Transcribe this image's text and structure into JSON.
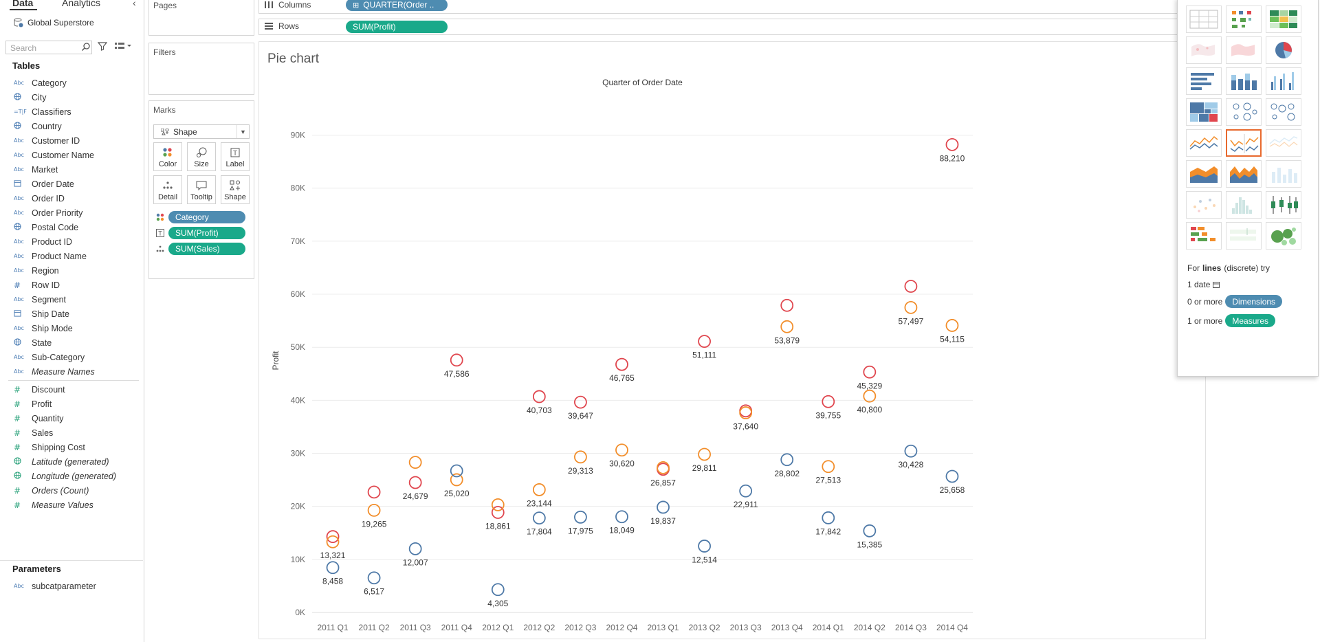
{
  "data_pane": {
    "tabs": [
      "Data",
      "Analytics"
    ],
    "datasource": "Global Superstore",
    "search_placeholder": "Search",
    "tables_heading": "Tables",
    "dimensions": [
      {
        "name": "Category",
        "type": "Abc"
      },
      {
        "name": "City",
        "type": "geo"
      },
      {
        "name": "Classifiers",
        "type": "=T|F"
      },
      {
        "name": "Country",
        "type": "geo"
      },
      {
        "name": "Customer ID",
        "type": "Abc"
      },
      {
        "name": "Customer Name",
        "type": "Abc"
      },
      {
        "name": "Market",
        "type": "Abc"
      },
      {
        "name": "Order Date",
        "type": "date"
      },
      {
        "name": "Order ID",
        "type": "Abc"
      },
      {
        "name": "Order Priority",
        "type": "Abc"
      },
      {
        "name": "Postal Code",
        "type": "geo"
      },
      {
        "name": "Product ID",
        "type": "Abc"
      },
      {
        "name": "Product Name",
        "type": "Abc"
      },
      {
        "name": "Region",
        "type": "Abc"
      },
      {
        "name": "Row ID",
        "type": "#"
      },
      {
        "name": "Segment",
        "type": "Abc"
      },
      {
        "name": "Ship Date",
        "type": "date"
      },
      {
        "name": "Ship Mode",
        "type": "Abc"
      },
      {
        "name": "State",
        "type": "geo"
      },
      {
        "name": "Sub-Category",
        "type": "Abc"
      },
      {
        "name": "Measure Names",
        "type": "Abc",
        "italic": true
      }
    ],
    "measures": [
      {
        "name": "Discount",
        "type": "#"
      },
      {
        "name": "Profit",
        "type": "#"
      },
      {
        "name": "Quantity",
        "type": "#"
      },
      {
        "name": "Sales",
        "type": "#"
      },
      {
        "name": "Shipping Cost",
        "type": "#"
      },
      {
        "name": "Latitude (generated)",
        "type": "geo",
        "italic": true
      },
      {
        "name": "Longitude (generated)",
        "type": "geo",
        "italic": true
      },
      {
        "name": "Orders (Count)",
        "type": "#",
        "italic": true
      },
      {
        "name": "Measure Values",
        "type": "#",
        "italic": true
      }
    ],
    "parameters_heading": "Parameters",
    "parameters": [
      {
        "name": "subcatparameter",
        "type": "Abc"
      }
    ]
  },
  "cards": {
    "pages": "Pages",
    "filters": "Filters",
    "marks": "Marks",
    "mark_type": "Shape",
    "mark_buttons": [
      "Color",
      "Size",
      "Label",
      "Detail",
      "Tooltip",
      "Shape"
    ],
    "mark_pills": [
      {
        "label": "Category",
        "kind": "dimension",
        "encoding": "color"
      },
      {
        "label": "SUM(Profit)",
        "kind": "measure",
        "encoding": "label"
      },
      {
        "label": "SUM(Sales)",
        "kind": "measure",
        "encoding": "detail"
      }
    ]
  },
  "shelves": {
    "columns_label": "Columns",
    "columns_pill": "QUARTER(Order ..",
    "rows_label": "Rows",
    "rows_pill": "SUM(Profit)"
  },
  "sheet_title": "Pie chart",
  "colors": {
    "red": "#e0464e",
    "orange": "#f28e2b",
    "blue": "#4e79a7",
    "dim_pill": "#4e8cb1",
    "measure_pill": "#1aa98a",
    "selected_thumb": "#e8692d"
  },
  "chart_data": {
    "type": "scatter",
    "title": "Quarter of Order Date",
    "ylabel": "Profit",
    "categories": [
      "2011 Q1",
      "2011 Q2",
      "2011 Q3",
      "2011 Q4",
      "2012 Q1",
      "2012 Q2",
      "2012 Q3",
      "2012 Q4",
      "2013 Q1",
      "2013 Q2",
      "2013 Q3",
      "2013 Q4",
      "2014 Q1",
      "2014 Q2",
      "2014 Q3",
      "2014 Q4"
    ],
    "ylim": [
      0,
      95000
    ],
    "yticks": [
      0,
      10000,
      20000,
      30000,
      40000,
      50000,
      60000,
      70000,
      80000,
      90000
    ],
    "ytick_labels": [
      "0K",
      "10K",
      "20K",
      "30K",
      "40K",
      "50K",
      "60K",
      "70K",
      "80K",
      "90K"
    ],
    "series": [
      {
        "color": "red",
        "values": [
          14300,
          22700,
          24500,
          47586,
          18861,
          40703,
          39647,
          46765,
          27000,
          51111,
          38000,
          57900,
          39755,
          45329,
          61500,
          88210
        ]
      },
      {
        "color": "orange",
        "values": [
          13321,
          19265,
          28300,
          25020,
          20300,
          23144,
          29313,
          30620,
          27300,
          29811,
          37640,
          53879,
          27513,
          40800,
          57497,
          54115
        ]
      },
      {
        "color": "blue",
        "values": [
          8458,
          6517,
          12007,
          26700,
          4305,
          17804,
          17975,
          18049,
          19837,
          12514,
          22911,
          28802,
          17842,
          15385,
          30428,
          25658
        ]
      }
    ],
    "data_labels": [
      {
        "category": "2011 Q1",
        "text": "13,321"
      },
      {
        "category": "2011 Q1",
        "text": "8,458"
      },
      {
        "category": "2011 Q2",
        "text": "19,265"
      },
      {
        "category": "2011 Q2",
        "text": "6,517"
      },
      {
        "category": "2011 Q3",
        "text": "24,679"
      },
      {
        "category": "2011 Q3",
        "text": "12,007"
      },
      {
        "category": "2011 Q4",
        "text": "47,586"
      },
      {
        "category": "2011 Q4",
        "text": "25,020"
      },
      {
        "category": "2012 Q1",
        "text": "18,861"
      },
      {
        "category": "2012 Q1",
        "text": "4,305"
      },
      {
        "category": "2012 Q2",
        "text": "40,703"
      },
      {
        "category": "2012 Q2",
        "text": "23,144"
      },
      {
        "category": "2012 Q2",
        "text": "17,804"
      },
      {
        "category": "2012 Q3",
        "text": "39,647"
      },
      {
        "category": "2012 Q3",
        "text": "29,313"
      },
      {
        "category": "2012 Q3",
        "text": "17,975"
      },
      {
        "category": "2012 Q4",
        "text": "46,765"
      },
      {
        "category": "2012 Q4",
        "text": "30,620"
      },
      {
        "category": "2012 Q4",
        "text": "18,049"
      },
      {
        "category": "2013 Q1",
        "text": "26,857"
      },
      {
        "category": "2013 Q1",
        "text": "19,837"
      },
      {
        "category": "2013 Q2",
        "text": "51,111"
      },
      {
        "category": "2013 Q2",
        "text": "29,811"
      },
      {
        "category": "2013 Q2",
        "text": "12,514"
      },
      {
        "category": "2013 Q3",
        "text": "37,640"
      },
      {
        "category": "2013 Q3",
        "text": "22,911"
      },
      {
        "category": "2013 Q4",
        "text": "53,879"
      },
      {
        "category": "2013 Q4",
        "text": "28,802"
      },
      {
        "category": "2014 Q1",
        "text": "39,755"
      },
      {
        "category": "2014 Q1",
        "text": "27,513"
      },
      {
        "category": "2014 Q1",
        "text": "17,842"
      },
      {
        "category": "2014 Q2",
        "text": "45,329"
      },
      {
        "category": "2014 Q2",
        "text": "40,800"
      },
      {
        "category": "2014 Q2",
        "text": "15,385"
      },
      {
        "category": "2014 Q3",
        "text": "57,497"
      },
      {
        "category": "2014 Q3",
        "text": "30,428"
      },
      {
        "category": "2014 Q4",
        "text": "88,210"
      },
      {
        "category": "2014 Q4",
        "text": "54,115"
      },
      {
        "category": "2014 Q4",
        "text": "25,658"
      }
    ],
    "grid": true,
    "legend": "none"
  },
  "show_me": {
    "selected": "dual-lines",
    "hint_prefix": "For",
    "hint_bold": "lines",
    "hint_suffix": "(discrete) try",
    "hint_date": "1 date",
    "hint_dims_prefix": "0 or more",
    "hint_dims_pill": "Dimensions",
    "hint_meas_prefix": "1 or more",
    "hint_meas_pill": "Measures"
  }
}
